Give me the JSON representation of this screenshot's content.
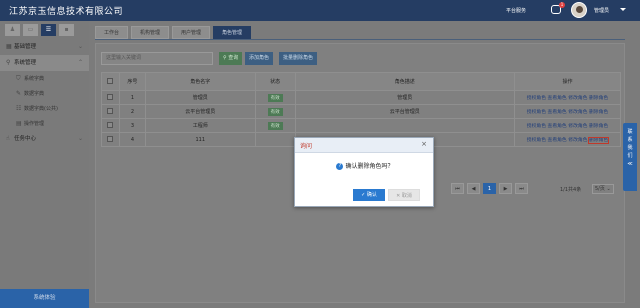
{
  "header": {
    "brand": "江苏京玉信息技术有限公司",
    "service": "平台服务",
    "badge": "1",
    "user": "管理员"
  },
  "sidebar": {
    "items": [
      {
        "label": "基础管理",
        "icon": "grid-icon"
      },
      {
        "label": "系统管理",
        "icon": "search-icon"
      },
      {
        "label": "系统字典",
        "icon": "shield-icon"
      },
      {
        "label": "数据字典",
        "icon": "pen-icon"
      },
      {
        "label": "数据字典(公共)",
        "icon": "list-icon"
      },
      {
        "label": "操作管理",
        "icon": "table-icon"
      },
      {
        "label": "任务中心",
        "icon": "hand-icon"
      }
    ],
    "footer": "系统体验"
  },
  "tabs": [
    "工作台",
    "机构管理",
    "用户管理",
    "角色管理"
  ],
  "toolbar": {
    "search_placeholder": "这里输入关键词",
    "query": "查询",
    "add": "添加角色",
    "batch_delete": "批量删除角色"
  },
  "table": {
    "headers": [
      "序号",
      "角色名字",
      "状态",
      "角色描述",
      "操作"
    ],
    "rows": [
      {
        "no": "1",
        "name": "管理员",
        "state": "有效",
        "desc": "管理员"
      },
      {
        "no": "2",
        "name": "云平台管理员",
        "state": "有效",
        "desc": "云平台管理员"
      },
      {
        "no": "3",
        "name": "工程师",
        "state": "有效",
        "desc": ""
      },
      {
        "no": "4",
        "name": "111",
        "state": "",
        "desc": ""
      }
    ],
    "ops": {
      "grant": "授权角色",
      "view": "查看角色",
      "edit": "修改角色",
      "delete": "删除角色"
    }
  },
  "pager": {
    "current": "1",
    "info": "1/1共4条",
    "size": "5/页"
  },
  "drawer": [
    "联",
    "系",
    "我",
    "们",
    "≪"
  ],
  "modal": {
    "title": "询问",
    "message": "确认删除角色吗？",
    "ok": "确认",
    "cancel": "取消"
  }
}
